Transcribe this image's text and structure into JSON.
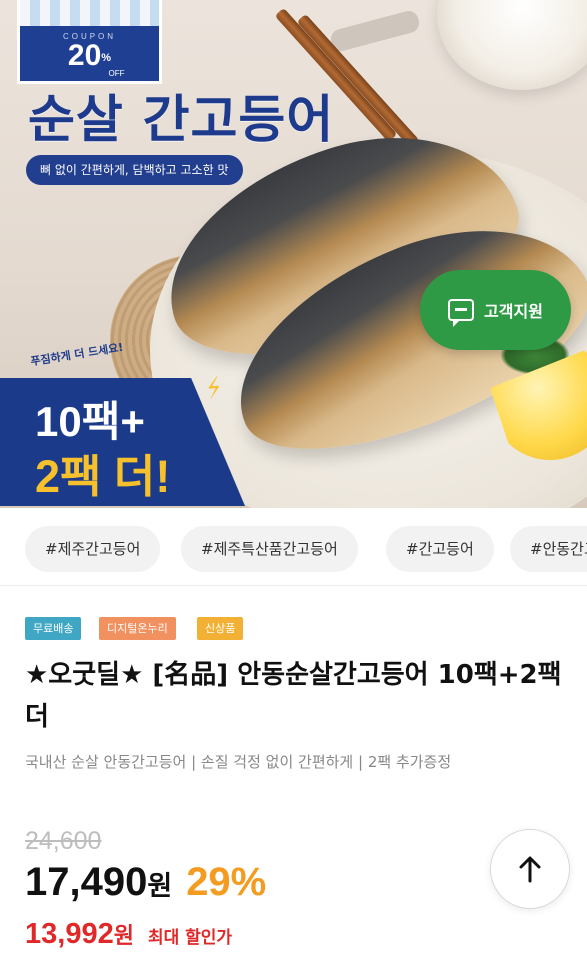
{
  "hero": {
    "coupon_label": "COUPON",
    "coupon_value": "20",
    "coupon_percent": "%",
    "coupon_off": "OFF",
    "headline": "순살 간고등어",
    "subtitle": "뼈 없이 간편하게, 담백하고 고소한 맛",
    "script_text": "푸짐하게 더 드세요!",
    "promo_line1": "10팩+",
    "promo_line2": "2팩 더!"
  },
  "support_button": {
    "label": "고객지원",
    "icon": "chat-icon"
  },
  "tags": [
    "#제주간고등어",
    "#제주특산품간고등어",
    "#간고등어",
    "#안동간고등어"
  ],
  "badges": [
    {
      "label": "무료배송",
      "color": "#3fa7c4"
    },
    {
      "label": "디지털온누리",
      "color": "#f0915f"
    },
    {
      "label": "신상품",
      "color": "#f2b035"
    }
  ],
  "product": {
    "title": "★오굿딜★ [名品] 안동순살간고등어 10팩+2팩더",
    "description": "국내산 순살 안동간고등어 | 손질 걱정 없이 간편하게 | 2팩 추가증정",
    "original_price": "24,600",
    "price": "17,490",
    "currency": "원",
    "discount_rate": "29%",
    "max_sale_price": "13,992",
    "max_sale_currency": "원",
    "max_sale_label": "최대 할인가"
  },
  "scroll_top_button": {
    "icon": "arrow-up-icon"
  },
  "colors": {
    "brand_blue": "#1d3a8c",
    "support_green": "#2f9a45",
    "discount_orange": "#f39c21",
    "sale_red": "#e02828"
  }
}
